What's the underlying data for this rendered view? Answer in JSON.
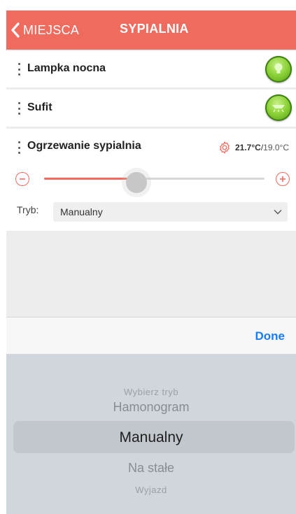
{
  "header": {
    "back_label": "MIEJSCA",
    "title": "SYPIALNIA",
    "color": "#ef6b5e"
  },
  "devices": [
    {
      "name": "Lampka nocna",
      "icon": "light-bulb-icon",
      "state": "on"
    },
    {
      "name": "Sufit",
      "icon": "ceiling-light-icon",
      "state": "on"
    }
  ],
  "heating": {
    "name": "Ogrzewanie sypialnia",
    "current_temp": "21.7°C",
    "separator": "/",
    "target_temp": "19.0°C",
    "slider_fraction": 0.42,
    "mode_label": "Tryb:",
    "mode_value": "Manualny"
  },
  "toolbar": {
    "done_label": "Done",
    "done_color": "#1a7cf1"
  },
  "picker": {
    "options": [
      "Wybierz tryb",
      "Hamonogram",
      "Manualny",
      "Na stałe",
      "Wyjazd"
    ],
    "selected": "Manualny"
  }
}
